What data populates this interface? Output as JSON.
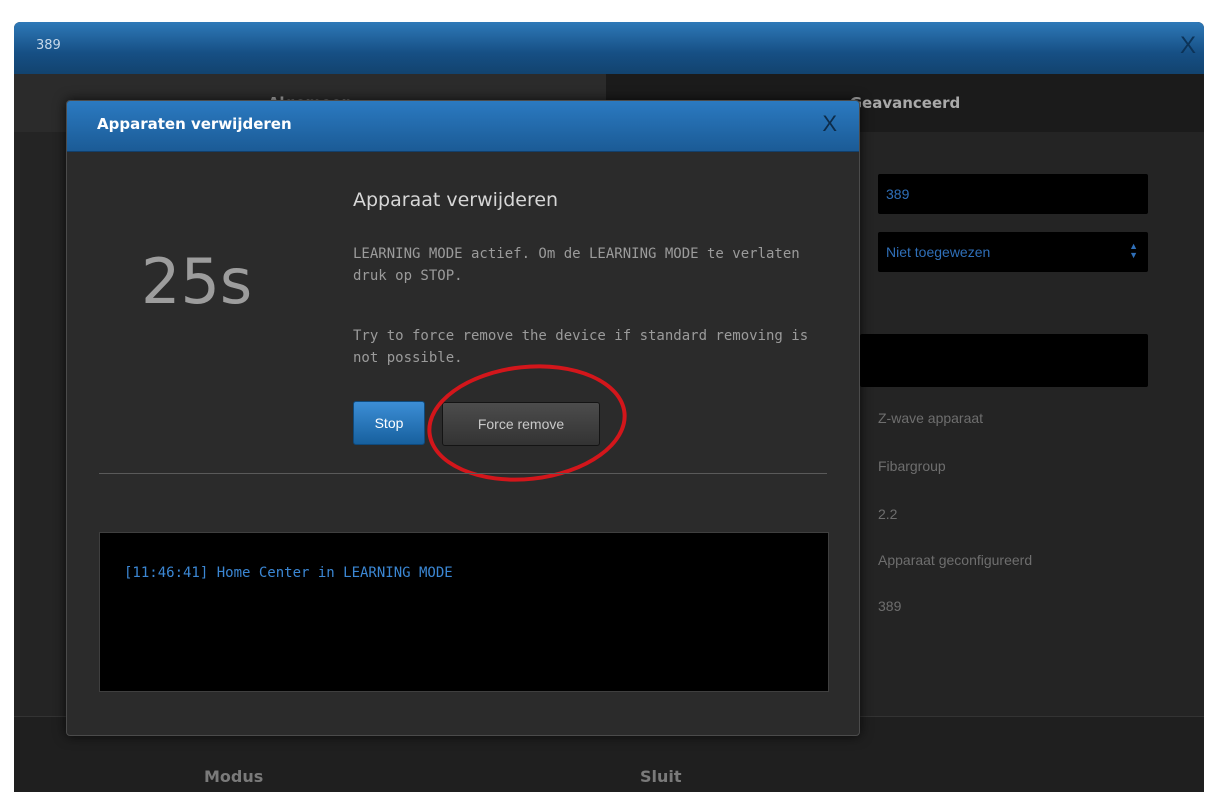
{
  "outer_dialog": {
    "title": "389",
    "close_label": "X",
    "tabs": [
      {
        "label": "Algemeen"
      },
      {
        "label": "Geavanceerd"
      }
    ],
    "fields": {
      "id_value": "389",
      "room_select": "Niet toegewezen"
    },
    "info": [
      "Z-wave apparaat",
      "Fibargroup",
      "2.2",
      "Apparaat geconfigureerd",
      "389"
    ],
    "bottom_labels": [
      "Modus",
      "Sluit"
    ]
  },
  "modal": {
    "title": "Apparaten verwijderen",
    "close_label": "X",
    "countdown": "25s",
    "subtitle": "Apparaat verwijderen",
    "message1": "LEARNING MODE actief. Om de LEARNING MODE te verlaten druk op STOP.",
    "message2": "Try to force remove the device if standard removing is not possible.",
    "stop_label": "Stop",
    "force_label": "Force remove",
    "log_entry": "[11:46:41] Home Center in LEARNING MODE"
  },
  "colors": {
    "header_blue": "#1b5b96",
    "annotation_red": "#d3161b",
    "log_text": "#3b87d4"
  }
}
